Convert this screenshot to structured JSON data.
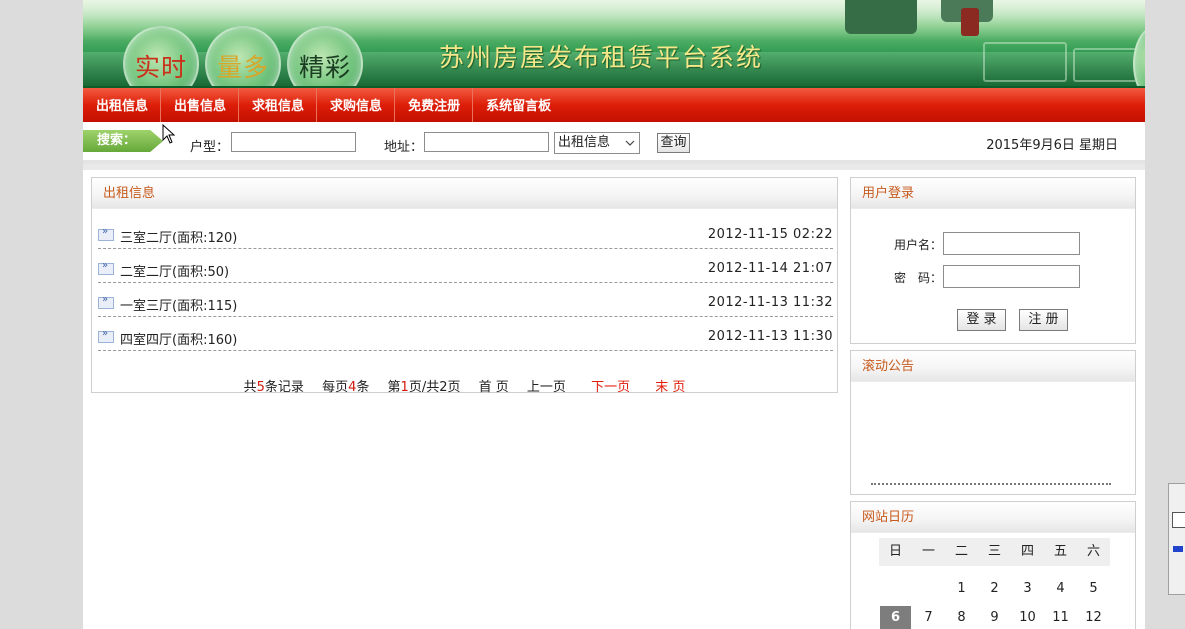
{
  "banner": {
    "badges": [
      {
        "text": "实时",
        "color": "#c8321a"
      },
      {
        "text": "量多",
        "color": "#d8a62a"
      },
      {
        "text": "精彩",
        "color": "#1b3d22"
      }
    ],
    "title": "苏州房屋发布租赁平台系统"
  },
  "nav": {
    "items": [
      "出租信息",
      "出售信息",
      "求租信息",
      "求购信息",
      "免费注册",
      "系统留言板"
    ]
  },
  "search": {
    "tag_label": "搜索：",
    "type_label": "户型：",
    "type_value": "",
    "address_label": "地址：",
    "address_value": "",
    "select_value": "出租信息",
    "query_button": "查询",
    "date_text": "2015年9月6日 星期日"
  },
  "listing": {
    "heading": "出租信息",
    "rows": [
      {
        "title": "三室二厅(面积:120)",
        "date": "2012-11-15 02:22"
      },
      {
        "title": "二室二厅(面积:50)",
        "date": "2012-11-14 21:07"
      },
      {
        "title": "一室三厅(面积:115)",
        "date": "2012-11-13 11:32"
      },
      {
        "title": "四室四厅(面积:160)",
        "date": "2012-11-13 11:30"
      }
    ],
    "pager": {
      "total_prefix": "共",
      "total_num": "5",
      "total_suffix": "条记录",
      "per_prefix": "每页",
      "per_num": "4",
      "per_suffix": "条",
      "page_prefix": "第",
      "page_num": "1",
      "page_suffix": "页/共2页",
      "first": "首 页",
      "prev": "上一页",
      "next": "下一页",
      "last": "末 页"
    }
  },
  "login": {
    "heading": "用户登录",
    "username_label": "用户名：",
    "username_value": "",
    "password_label": "密　码：",
    "password_value": "",
    "login_button": "登 录",
    "register_button": "注 册"
  },
  "notice": {
    "heading": "滚动公告"
  },
  "calendar": {
    "heading": "网站日历",
    "weekdays": [
      "日",
      "一",
      "二",
      "三",
      "四",
      "五",
      "六"
    ],
    "week1": [
      "",
      "",
      "1",
      "2",
      "3",
      "4",
      "5"
    ],
    "week2": [
      "6",
      "7",
      "8",
      "9",
      "10",
      "11",
      "12"
    ],
    "today": "6"
  },
  "colors": {
    "nav_red": "#dd1e08",
    "panel_heading": "#c75a1c",
    "pager_highlight": "#e31b0a",
    "banner_title": "#f6e88a"
  }
}
